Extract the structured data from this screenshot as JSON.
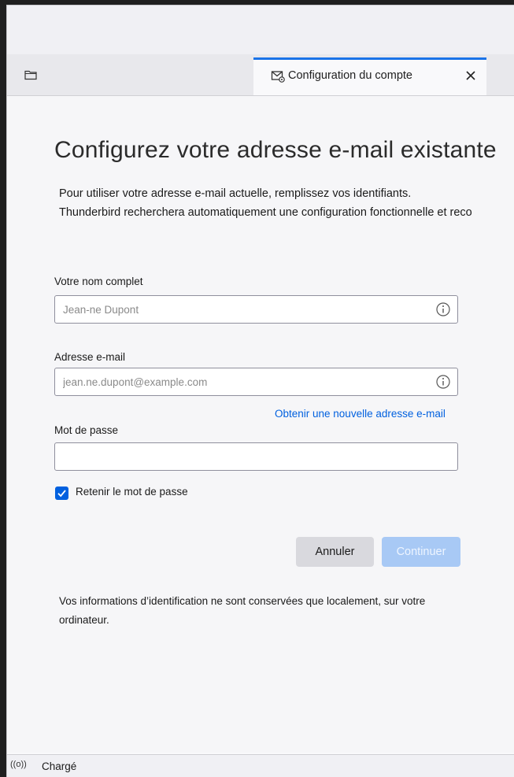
{
  "tab": {
    "title": "Configuration du compte",
    "close_glyph": "✕"
  },
  "page": {
    "heading": "Configurez votre adresse e-mail existante",
    "subtitle_line1": "Pour utiliser votre adresse e-mail actuelle, remplissez vos identifiants.",
    "subtitle_line2": "Thunderbird recherchera automatiquement une configuration fonctionnelle et reco"
  },
  "form": {
    "name_label": "Votre nom complet",
    "name_placeholder": "Jean-ne Dupont",
    "email_label": "Adresse e-mail",
    "email_placeholder": "jean.ne.dupont@example.com",
    "new_email_link": "Obtenir une nouvelle adresse e-mail",
    "password_label": "Mot de passe",
    "password_value": "",
    "remember_label": "Retenir le mot de passe",
    "remember_checked": true
  },
  "buttons": {
    "cancel": "Annuler",
    "continue": "Continuer"
  },
  "footnote": "Vos informations d’identification ne sont conservées que localement, sur votre ordinateur.",
  "status": {
    "icon": "((o))",
    "text": "Chargé"
  },
  "colors": {
    "accent": "#0060df",
    "tab_indicator": "#1a73e8",
    "continue_disabled": "#a8c9f5",
    "cancel_bg": "#d9d9de"
  }
}
